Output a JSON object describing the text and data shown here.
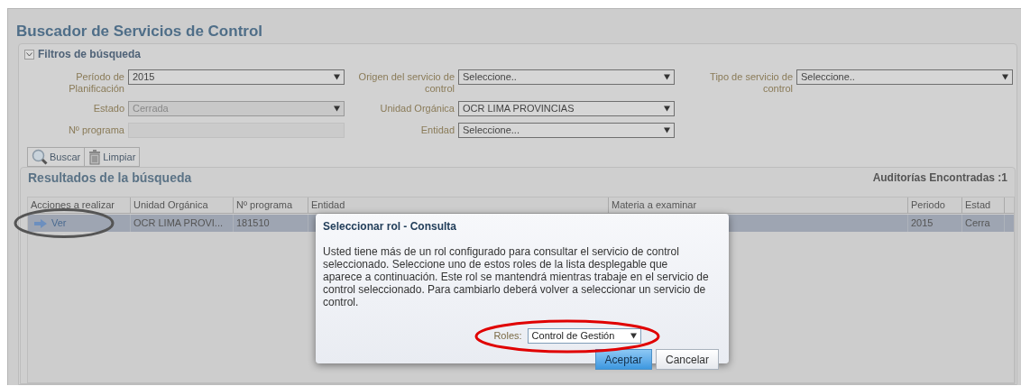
{
  "page": {
    "title": "Buscador de Servicios de Control"
  },
  "filters": {
    "title": "Filtros de búsqueda",
    "expanded": true,
    "rows": [
      [
        {
          "kind": "select",
          "label": "Período de Planificación",
          "value": "2015",
          "disabled": false
        },
        {
          "kind": "select",
          "label": "Origen del servicio de control",
          "value": "Seleccione..",
          "disabled": false
        },
        {
          "kind": "select",
          "label": "Tipo de servicio de control",
          "value": "Seleccione..",
          "disabled": false
        }
      ],
      [
        {
          "kind": "select",
          "label": "Estado",
          "value": "Cerrada",
          "disabled": true
        },
        {
          "kind": "select",
          "label": "Unidad Orgánica",
          "value": "OCR LIMA PROVINCIAS",
          "disabled": false
        }
      ],
      [
        {
          "kind": "text",
          "label": "Nº programa",
          "disabled": true
        },
        {
          "kind": "select",
          "label": "Entidad",
          "value": "Seleccione...",
          "disabled": false
        }
      ]
    ],
    "buttons": [
      {
        "kind": "search",
        "label": "Buscar"
      },
      {
        "kind": "clear",
        "label": "Limpiar"
      }
    ]
  },
  "results": {
    "title": "Resultados de la búsqueda",
    "count": "Auditorías Encontradas :1",
    "columns": [
      "Acciones a realizar",
      "Unidad Orgánica",
      "Nº programa",
      "Entidad",
      "Materia a examinar",
      "Periodo",
      "Estad"
    ],
    "rows": [
      {
        "selected": true,
        "action": "Ver",
        "unidad": "OCR LIMA PROVI...",
        "programa": "181510",
        "periodo": "2015",
        "estado": "Cerra"
      }
    ]
  },
  "dialog": {
    "title": "Seleccionar rol - Consulta",
    "message": "Usted tiene más de un rol configurado para consultar el servicio de control seleccionado. Seleccione uno de estos roles de la lista desplegable que aparece a continuación. Este rol se mantendrá mientras trabaje en el servicio de control seleccionado. Para cambiarlo deberá volver a seleccionar un servicio de control.",
    "roles_label": "Roles:",
    "role_value": "Control de Gestión",
    "buttons": [
      {
        "label": "Aceptar",
        "primary": true
      },
      {
        "label": "Cancelar",
        "primary": false
      }
    ]
  },
  "annotations": [
    {
      "kind": "ellipse",
      "color": "#555555"
    },
    {
      "kind": "ellipse",
      "color": "#e00000"
    }
  ]
}
